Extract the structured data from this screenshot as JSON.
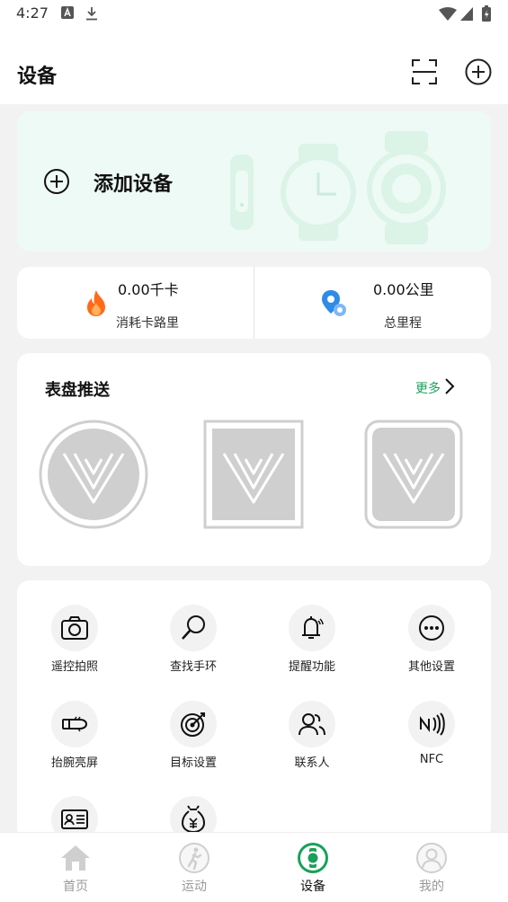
{
  "status_bar": {
    "time": "4:27"
  },
  "header": {
    "title": "设备"
  },
  "add_device": {
    "label": "添加设备"
  },
  "stats": {
    "calories": {
      "value": "0.00千卡",
      "label": "消耗卡路里"
    },
    "distance": {
      "value": "0.00公里",
      "label": "总里程"
    }
  },
  "watch_faces": {
    "title": "表盘推送",
    "more_label": "更多"
  },
  "functions": [
    {
      "label": "遥控拍照",
      "icon": "camera-icon"
    },
    {
      "label": "查找手环",
      "icon": "magnifier-icon"
    },
    {
      "label": "提醒功能",
      "icon": "bell-icon"
    },
    {
      "label": "其他设置",
      "icon": "more-dots-icon"
    },
    {
      "label": "抬腕亮屏",
      "icon": "raise-wrist-icon"
    },
    {
      "label": "目标设置",
      "icon": "target-icon"
    },
    {
      "label": "联系人",
      "icon": "contacts-icon"
    },
    {
      "label": "NFC",
      "icon": "nfc-icon"
    },
    {
      "label": "",
      "icon": "id-card-icon"
    },
    {
      "label": "",
      "icon": "money-bag-icon"
    }
  ],
  "bottom_nav": [
    {
      "label": "首页",
      "icon": "home-icon",
      "active": false
    },
    {
      "label": "运动",
      "icon": "running-icon",
      "active": false
    },
    {
      "label": "设备",
      "icon": "watch-icon",
      "active": true
    },
    {
      "label": "我的",
      "icon": "profile-icon",
      "active": false
    }
  ],
  "colors": {
    "accent": "#1aa05a",
    "add_card_bg": "#eefaf5",
    "page_bg": "#f2f2f2",
    "flame": "#ff6a1a",
    "distance_icon": "#2e8be6"
  }
}
